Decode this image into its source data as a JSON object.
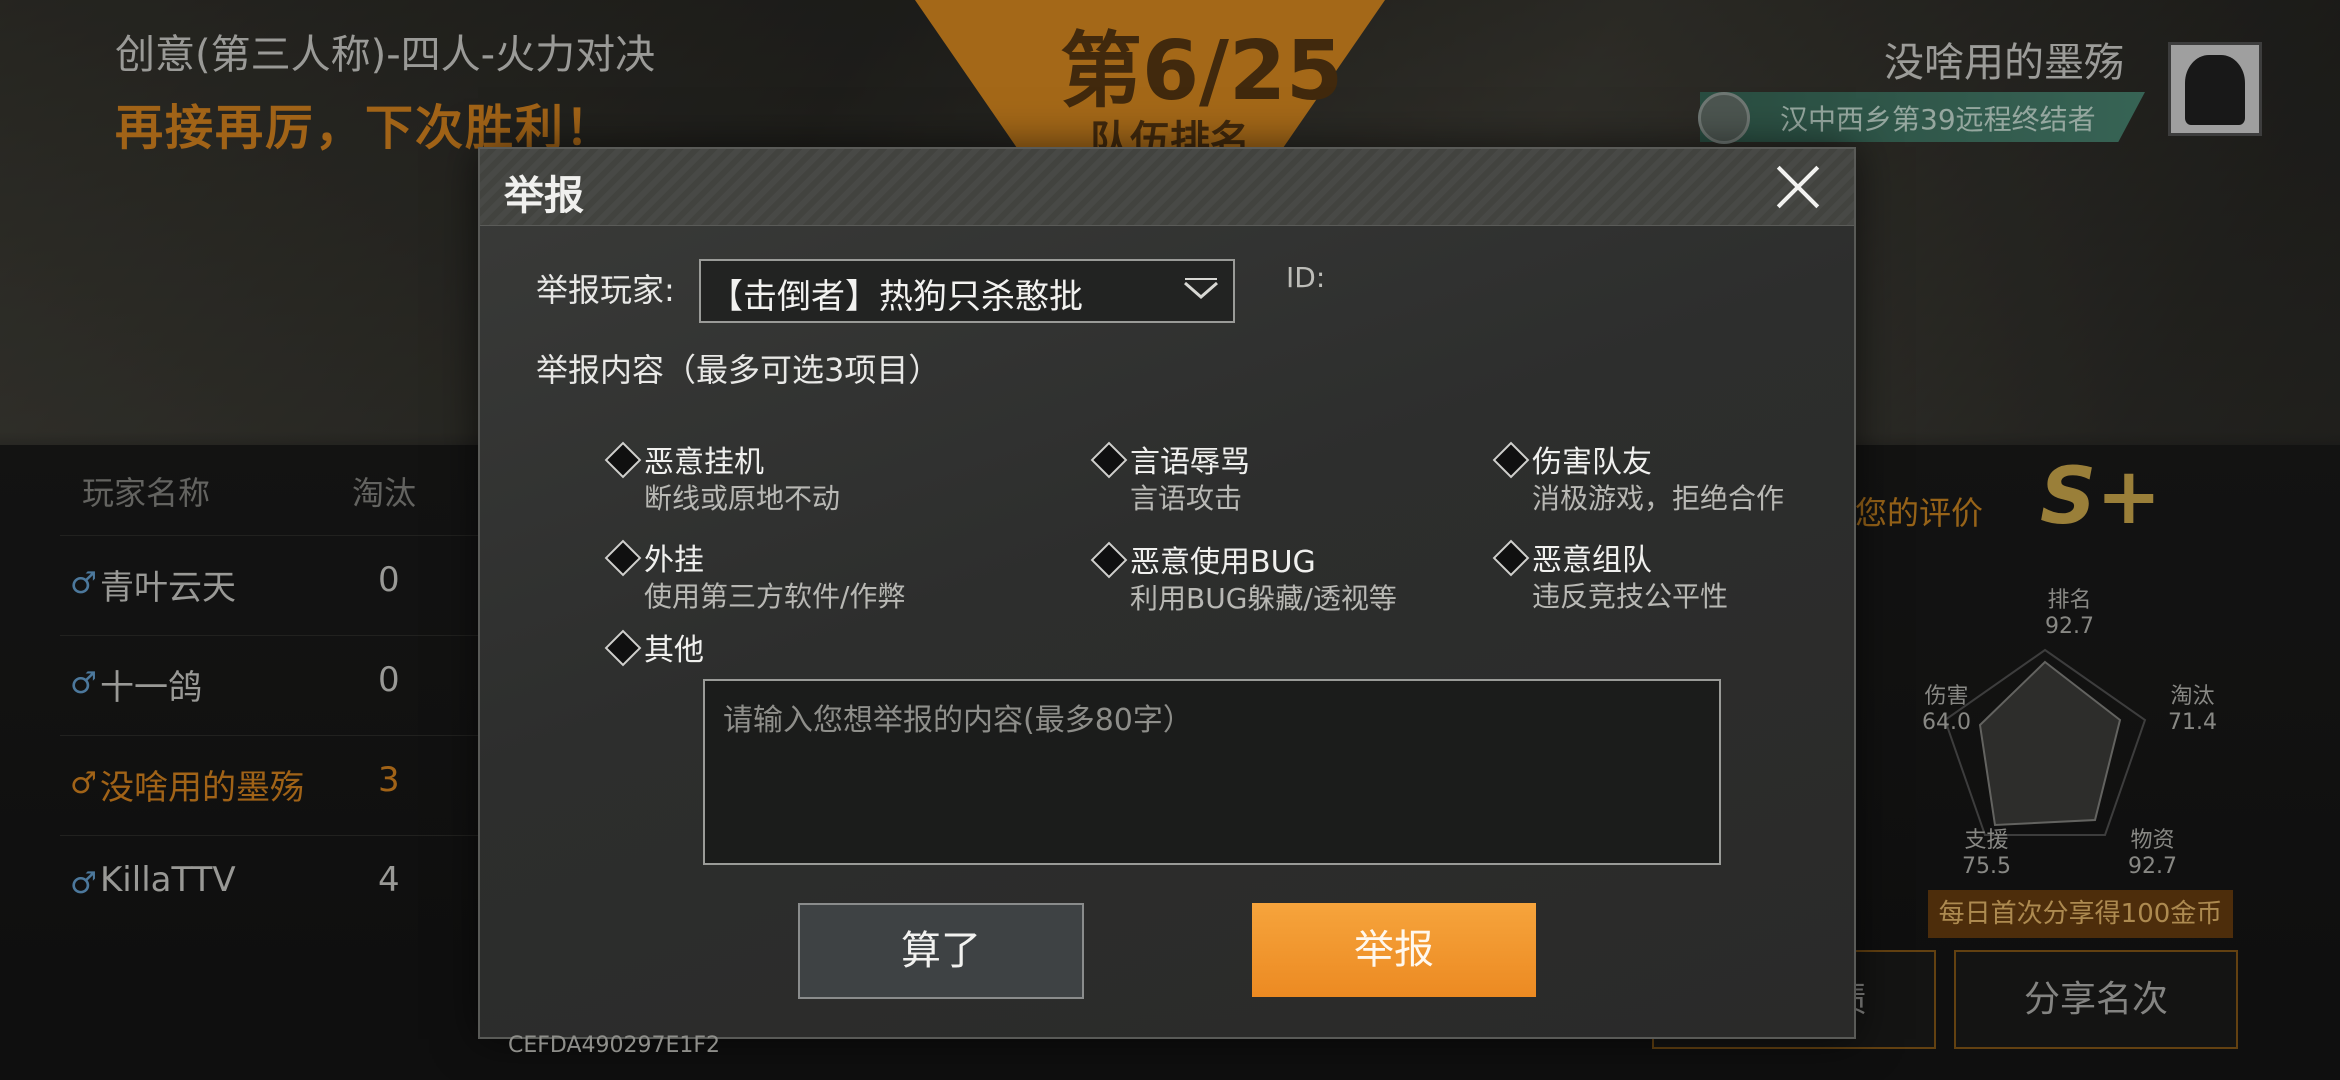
{
  "background": {
    "mode_title": "创意(第三人称)-四人-火力对决",
    "result_message": "再接再厉，下次胜利！",
    "rank": "第6/25",
    "rank_label": "队伍排名",
    "player_name": "没啥用的墨殇",
    "player_title": "汉中西乡第39远程终结者",
    "table_headers": [
      "玩家名称",
      "淘汰"
    ],
    "rows": [
      {
        "name": "青叶云天",
        "kills": "0"
      },
      {
        "name": "十一鸽",
        "kills": "0"
      },
      {
        "name": "没啥用的墨殇",
        "kills": "3"
      },
      {
        "name": "KillaTTV",
        "kills": "4"
      }
    ],
    "evaluation_label": "您的评价",
    "grade": "S+",
    "radar": [
      {
        "label": "排名",
        "value": "92.7"
      },
      {
        "label": "淘汰",
        "value": "71.4"
      },
      {
        "label": "物资",
        "value": "92.7"
      },
      {
        "label": "支援",
        "value": "75.5"
      },
      {
        "label": "伤害",
        "value": "64.0"
      }
    ],
    "share_promo": "每日首次分享得100金币",
    "share_rank_button": "分享名次",
    "share_record_button": "分享战绩"
  },
  "dialog": {
    "title": "举报",
    "player_label": "举报玩家:",
    "player_value": "【击倒者】热狗只杀憨批",
    "id_label": "ID:",
    "content_label": "举报内容（最多可选3项目）",
    "options": [
      {
        "title": "恶意挂机",
        "sub": "断线或原地不动"
      },
      {
        "title": "言语辱骂",
        "sub": "言语攻击"
      },
      {
        "title": "伤害队友",
        "sub": "消极游戏，拒绝合作"
      },
      {
        "title": "外挂",
        "sub": "使用第三方软件/作弊"
      },
      {
        "title": "恶意使用BUG",
        "sub": "利用BUG躲藏/透视等"
      },
      {
        "title": "恶意组队",
        "sub": "违反竞技公平性"
      },
      {
        "title": "其他",
        "sub": ""
      }
    ],
    "textarea_placeholder": "请输入您想举报的内容(最多80字）",
    "cancel_button": "算了",
    "report_button": "举报",
    "watermark": "CEFDA490297E1F2"
  },
  "colors": {
    "accent_orange": "#EC8A22",
    "title_orange": "#E08A20"
  }
}
